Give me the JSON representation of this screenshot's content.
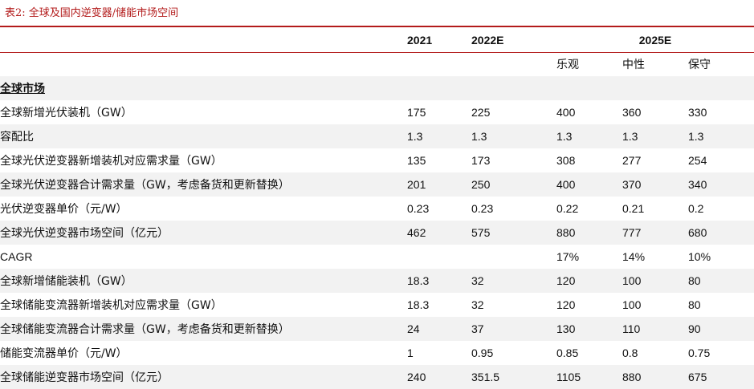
{
  "caption": "表2:  全球及国内逆变器/储能市场空间",
  "header": {
    "c2021": "2021",
    "c2022": "2022E",
    "c2025": "2025E"
  },
  "subheader": {
    "optimistic": "乐观",
    "neutral": "中性",
    "conservative": "保守"
  },
  "section_title": "全球市场",
  "rows": [
    {
      "label": "全球新增光伏装机（GW）",
      "v2021": "175",
      "v2022": "225",
      "opt": "400",
      "neu": "360",
      "con": "330"
    },
    {
      "label": "容配比",
      "v2021": "1.3",
      "v2022": "1.3",
      "opt": "1.3",
      "neu": "1.3",
      "con": "1.3"
    },
    {
      "label": "全球光伏逆变器新增装机对应需求量（GW）",
      "v2021": "135",
      "v2022": "173",
      "opt": "308",
      "neu": "277",
      "con": "254"
    },
    {
      "label": "全球光伏逆变器合计需求量（GW，考虑备货和更新替换）",
      "v2021": "201",
      "v2022": "250",
      "opt": "400",
      "neu": "370",
      "con": "340"
    },
    {
      "label": "光伏逆变器单价（元/W）",
      "v2021": "0.23",
      "v2022": "0.23",
      "opt": "0.22",
      "neu": "0.21",
      "con": "0.2"
    },
    {
      "label": "全球光伏逆变器市场空间（亿元）",
      "v2021": "462",
      "v2022": "575",
      "opt": "880",
      "neu": "777",
      "con": "680"
    },
    {
      "label": "CAGR",
      "v2021": "",
      "v2022": "",
      "opt": "17%",
      "neu": "14%",
      "con": "10%"
    },
    {
      "label": "全球新增储能装机（GW）",
      "v2021": "18.3",
      "v2022": "32",
      "opt": "120",
      "neu": "100",
      "con": "80"
    },
    {
      "label": "全球储能变流器新增装机对应需求量（GW）",
      "v2021": "18.3",
      "v2022": "32",
      "opt": "120",
      "neu": "100",
      "con": "80"
    },
    {
      "label": "全球储能变流器合计需求量（GW，考虑备货和更新替换）",
      "v2021": "24",
      "v2022": "37",
      "opt": "130",
      "neu": "110",
      "con": "90"
    },
    {
      "label": "储能变流器单价（元/W）",
      "v2021": "1",
      "v2022": "0.95",
      "opt": "0.85",
      "neu": "0.8",
      "con": "0.75"
    },
    {
      "label": "全球储能逆变器市场空间（亿元）",
      "v2021": "240",
      "v2022": "351.5",
      "opt": "1105",
      "neu": "880",
      "con": "675"
    }
  ]
}
